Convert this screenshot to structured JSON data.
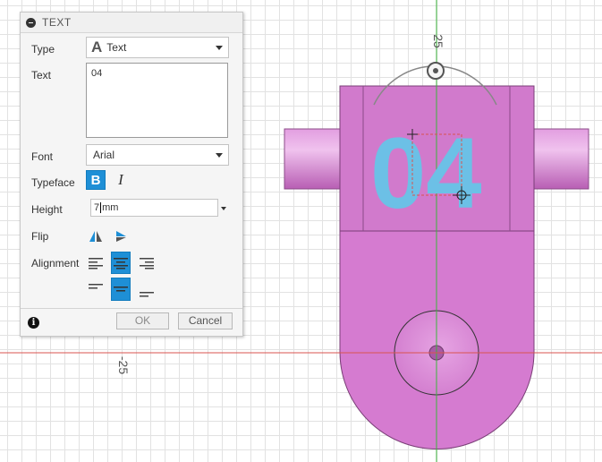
{
  "panel": {
    "title": "TEXT",
    "type_label": "Type",
    "type_value": "Text",
    "text_label": "Text",
    "text_value": "04",
    "font_label": "Font",
    "font_value": "Arial",
    "typeface_label": "Typeface",
    "bold_glyph": "B",
    "italic_glyph": "I",
    "height_label": "Height",
    "height_value_before_caret": "7",
    "height_value_after_caret": "mm",
    "flip_label": "Flip",
    "alignment_label": "Alignment",
    "info_glyph": "i",
    "ok_label": "OK",
    "cancel_label": "Cancel"
  },
  "viewport": {
    "axis_label_x": "25",
    "axis_label_y": "-25",
    "model_text": "04"
  },
  "colors": {
    "accent": "#1e8fd6",
    "model_body": "#d57bd0",
    "model_text": "#6cc0e6",
    "axis_green": "#3cb43c",
    "axis_red": "#d9534f"
  }
}
